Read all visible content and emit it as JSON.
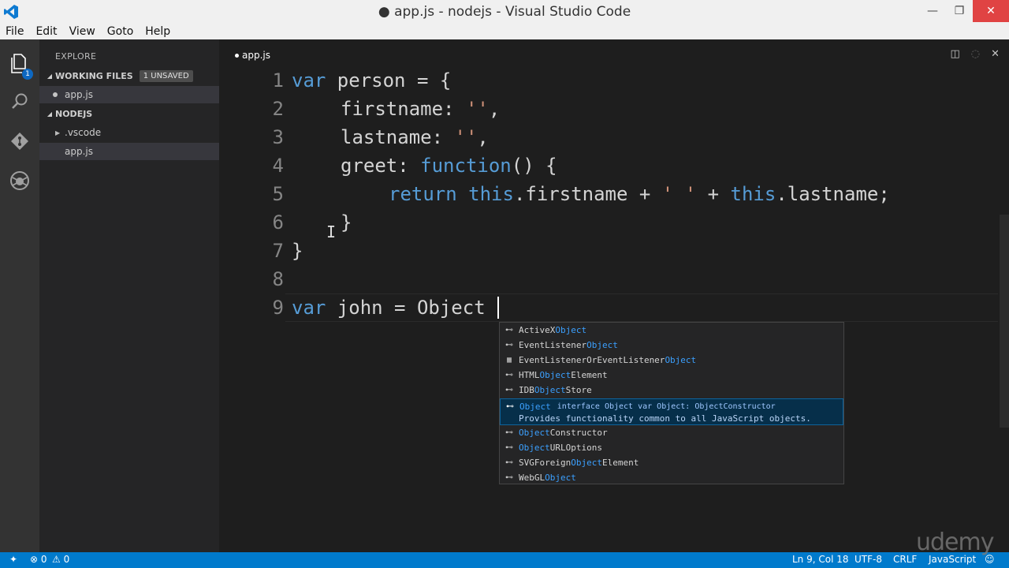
{
  "window": {
    "title": "● app.js - nodejs - Visual Studio Code",
    "controls": {
      "minimize": "—",
      "maximize": "❐",
      "close": "✕"
    }
  },
  "menu": [
    "File",
    "Edit",
    "View",
    "Goto",
    "Help"
  ],
  "activity": {
    "explorer_badge": "1"
  },
  "sidebar": {
    "title": "EXPLORE",
    "working_files": {
      "label": "WORKING FILES",
      "badge": "1 UNSAVED",
      "items": [
        "app.js"
      ]
    },
    "project": {
      "label": "NODEJS",
      "items": [
        ".vscode",
        "app.js"
      ]
    }
  },
  "editor": {
    "tab": "app.js",
    "line_numbers": [
      "1",
      "2",
      "3",
      "4",
      "5",
      "6",
      "7",
      "8",
      "9"
    ],
    "lines": {
      "l1": {
        "kw": "var",
        "rest": " person = {"
      },
      "l2": {
        "prop": "firstname: ",
        "str": "''",
        "end": ","
      },
      "l3": {
        "prop": "lastname: ",
        "str": "''",
        "end": ","
      },
      "l4": {
        "prop": "greet: ",
        "kw": "function",
        "end": "() {"
      },
      "l5": {
        "kw1": "return",
        "sp1": " ",
        "kw2": "this",
        "mid1": ".firstname + ",
        "str": "' '",
        "mid2": " + ",
        "kw3": "this",
        "end": ".lastname;"
      },
      "l6": "}",
      "l7": "}",
      "l9": {
        "kw": "var",
        "rest": " john = Object"
      }
    }
  },
  "suggest": {
    "items": [
      {
        "pre": "ActiveX",
        "hl": "Object",
        "post": ""
      },
      {
        "pre": "EventListener",
        "hl": "Object",
        "post": ""
      },
      {
        "pre": "EventListenerOrEventListener",
        "hl": "Object",
        "post": ""
      },
      {
        "pre": "HTML",
        "hl": "Object",
        "post": "Element"
      },
      {
        "pre": "IDB",
        "hl": "Object",
        "post": "Store"
      },
      {
        "pre": "",
        "hl": "Object",
        "post": "Constructor"
      },
      {
        "pre": "",
        "hl": "Object",
        "post": "URLOptions"
      },
      {
        "pre": "SVGForeign",
        "hl": "Object",
        "post": "Element"
      },
      {
        "pre": "WebGL",
        "hl": "Object",
        "post": ""
      }
    ],
    "selected": {
      "label": "Object",
      "type": "interface Object var Object: ObjectConstructor",
      "doc": "Provides functionality common to all JavaScript objects."
    }
  },
  "status": {
    "errors": "0",
    "warnings": "0",
    "position": "Ln 9, Col 18",
    "encoding": "UTF-8",
    "eol": "CRLF",
    "language": "JavaScript"
  },
  "watermark": "udemy",
  "colors": {
    "accent": "#007acc",
    "keyword": "#569cd6",
    "string": "#ce9178",
    "match": "#3ba0ff"
  }
}
